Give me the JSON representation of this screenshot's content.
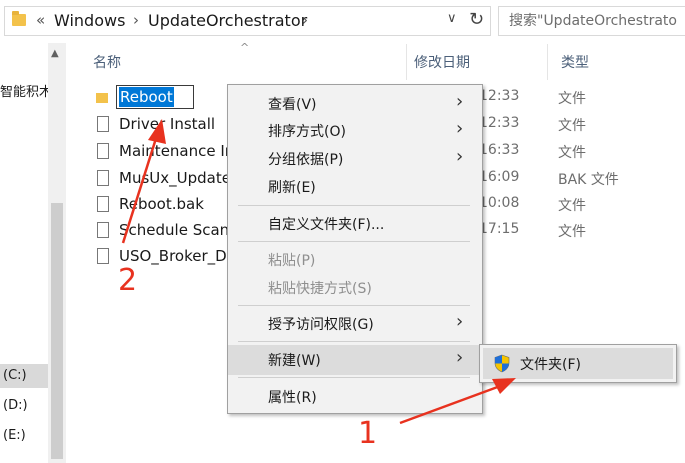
{
  "address_bar": {
    "chevrons": "«",
    "path": [
      "Windows",
      "UpdateOrchestrator"
    ],
    "separator": "›",
    "dropdown_glyph": "∨",
    "refresh_glyph": "↻",
    "search_placeholder": "搜索\"UpdateOrchestrato"
  },
  "nav": {
    "items": [
      {
        "label": "智能积木"
      },
      {
        "label": "(C:)",
        "selected": true
      },
      {
        "label": "(D:)"
      },
      {
        "label": "(E:)"
      }
    ],
    "scroll_up_glyph": "▲"
  },
  "columns": {
    "name": "名称",
    "date": "修改日期",
    "type": "类型",
    "sort_glyph": "^"
  },
  "files": [
    {
      "name": "Reboot",
      "date": "12:33",
      "type": "文件",
      "kind": "folder",
      "editing": true
    },
    {
      "name": "Driver Install",
      "date": "12:33",
      "type": "文件",
      "kind": "file"
    },
    {
      "name": "Maintenance In",
      "date": "16:33",
      "type": "文件",
      "kind": "file"
    },
    {
      "name": "MusUx_Update",
      "date": "16:09",
      "type": "BAK 文件",
      "kind": "file"
    },
    {
      "name": "Reboot.bak",
      "date": "10:08",
      "type": "文件",
      "kind": "file"
    },
    {
      "name": "Schedule Scan",
      "date": "17:15",
      "type": "文件",
      "kind": "file"
    },
    {
      "name": "USO_Broker_Di",
      "date": "",
      "type": "",
      "kind": "file"
    }
  ],
  "context_menu": {
    "items": [
      {
        "label": "查看(V)",
        "submenu": true,
        "disabled": false
      },
      {
        "label": "排序方式(O)",
        "submenu": true,
        "disabled": false
      },
      {
        "label": "分组依据(P)",
        "submenu": true,
        "disabled": false
      },
      {
        "label": "刷新(E)",
        "submenu": false,
        "disabled": false
      },
      {
        "label": "自定义文件夹(F)...",
        "submenu": false,
        "disabled": false
      },
      {
        "label": "粘贴(P)",
        "submenu": false,
        "disabled": true
      },
      {
        "label": "粘贴快捷方式(S)",
        "submenu": false,
        "disabled": true
      },
      {
        "label": "授予访问权限(G)",
        "submenu": true,
        "disabled": false
      },
      {
        "label": "新建(W)",
        "submenu": true,
        "disabled": false,
        "highlighted": true
      },
      {
        "label": "属性(R)",
        "submenu": false,
        "disabled": false
      }
    ],
    "submenu_glyph": "›"
  },
  "new_submenu": {
    "item_label": "文件夹(F)",
    "icon": "uac-shield-icon"
  },
  "annotations": {
    "step1": "1",
    "step2": "2",
    "color": "#e8321f"
  }
}
